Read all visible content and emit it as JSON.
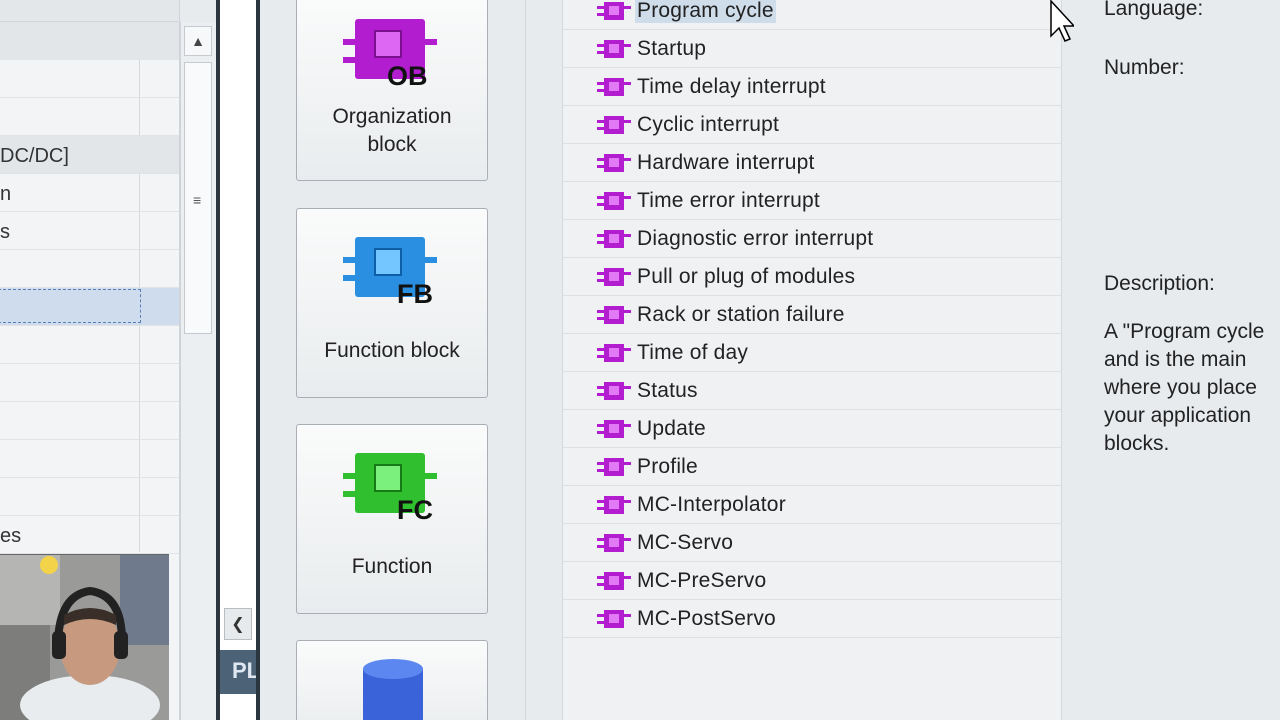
{
  "left_tree": {
    "rows": [
      {
        "label": "",
        "style": "grey"
      },
      {
        "label": "",
        "style": "normal"
      },
      {
        "label": "",
        "style": "normal"
      },
      {
        "label": "DC/DC]",
        "style": "grey"
      },
      {
        "label": "n",
        "style": "normal"
      },
      {
        "label": "s",
        "style": "normal"
      },
      {
        "label": "",
        "style": "normal"
      },
      {
        "label": "",
        "style": "selected"
      },
      {
        "label": "",
        "style": "normal"
      },
      {
        "label": "",
        "style": "normal"
      },
      {
        "label": "",
        "style": "normal"
      },
      {
        "label": "",
        "style": "normal"
      },
      {
        "label": "",
        "style": "normal"
      },
      {
        "label": "es",
        "style": "normal"
      }
    ]
  },
  "scrollbar": {
    "up_glyph": "▲",
    "grip_glyph": "≡"
  },
  "splitter": {
    "collapse_glyph": "❮",
    "tab_label": "PL"
  },
  "blocks": [
    {
      "id": "ob",
      "code": "OB",
      "label": "Organization\nblock",
      "color": "#b21ecf",
      "selected": true
    },
    {
      "id": "fb",
      "code": "FB",
      "label": "Function block",
      "color": "#2a8fe0",
      "selected": false
    },
    {
      "id": "fc",
      "code": "FC",
      "label": "Function",
      "color": "#2fbf2f",
      "selected": false
    },
    {
      "id": "db",
      "code": "DB",
      "label": "",
      "color": "#3b63d9",
      "selected": false
    }
  ],
  "ob_list": {
    "selected_index": 0,
    "items": [
      "Program cycle",
      "Startup",
      "Time delay interrupt",
      "Cyclic interrupt",
      "Hardware interrupt",
      "Time error interrupt",
      "Diagnostic error interrupt",
      "Pull or plug of modules",
      "Rack or station failure",
      "Time of day",
      "Status",
      "Update",
      "Profile",
      "MC-Interpolator",
      "MC-Servo",
      "MC-PreServo",
      "MC-PostServo"
    ]
  },
  "details": {
    "language_label": "Language:",
    "number_label": "Number:",
    "description_label": "Description:",
    "description_text": "A \"Program cycle\nand is the main \nwhere you place \nyour application\nblocks."
  },
  "colors": {
    "ob_purple": "#b21ecf",
    "selection_blue": "#cfdcea",
    "splitter_dark": "#2b3540"
  }
}
